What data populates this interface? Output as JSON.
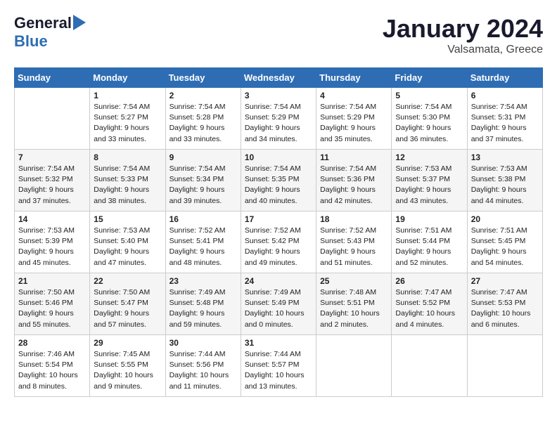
{
  "header": {
    "logo_general": "General",
    "logo_blue": "Blue",
    "month_title": "January 2024",
    "location": "Valsamata, Greece"
  },
  "days_of_week": [
    "Sunday",
    "Monday",
    "Tuesday",
    "Wednesday",
    "Thursday",
    "Friday",
    "Saturday"
  ],
  "weeks": [
    [
      {
        "day": "",
        "sunrise": "",
        "sunset": "",
        "daylight": ""
      },
      {
        "day": "1",
        "sunrise": "Sunrise: 7:54 AM",
        "sunset": "Sunset: 5:27 PM",
        "daylight": "Daylight: 9 hours and 33 minutes."
      },
      {
        "day": "2",
        "sunrise": "Sunrise: 7:54 AM",
        "sunset": "Sunset: 5:28 PM",
        "daylight": "Daylight: 9 hours and 33 minutes."
      },
      {
        "day": "3",
        "sunrise": "Sunrise: 7:54 AM",
        "sunset": "Sunset: 5:29 PM",
        "daylight": "Daylight: 9 hours and 34 minutes."
      },
      {
        "day": "4",
        "sunrise": "Sunrise: 7:54 AM",
        "sunset": "Sunset: 5:29 PM",
        "daylight": "Daylight: 9 hours and 35 minutes."
      },
      {
        "day": "5",
        "sunrise": "Sunrise: 7:54 AM",
        "sunset": "Sunset: 5:30 PM",
        "daylight": "Daylight: 9 hours and 36 minutes."
      },
      {
        "day": "6",
        "sunrise": "Sunrise: 7:54 AM",
        "sunset": "Sunset: 5:31 PM",
        "daylight": "Daylight: 9 hours and 37 minutes."
      }
    ],
    [
      {
        "day": "7",
        "sunrise": "Sunrise: 7:54 AM",
        "sunset": "Sunset: 5:32 PM",
        "daylight": "Daylight: 9 hours and 37 minutes."
      },
      {
        "day": "8",
        "sunrise": "Sunrise: 7:54 AM",
        "sunset": "Sunset: 5:33 PM",
        "daylight": "Daylight: 9 hours and 38 minutes."
      },
      {
        "day": "9",
        "sunrise": "Sunrise: 7:54 AM",
        "sunset": "Sunset: 5:34 PM",
        "daylight": "Daylight: 9 hours and 39 minutes."
      },
      {
        "day": "10",
        "sunrise": "Sunrise: 7:54 AM",
        "sunset": "Sunset: 5:35 PM",
        "daylight": "Daylight: 9 hours and 40 minutes."
      },
      {
        "day": "11",
        "sunrise": "Sunrise: 7:54 AM",
        "sunset": "Sunset: 5:36 PM",
        "daylight": "Daylight: 9 hours and 42 minutes."
      },
      {
        "day": "12",
        "sunrise": "Sunrise: 7:53 AM",
        "sunset": "Sunset: 5:37 PM",
        "daylight": "Daylight: 9 hours and 43 minutes."
      },
      {
        "day": "13",
        "sunrise": "Sunrise: 7:53 AM",
        "sunset": "Sunset: 5:38 PM",
        "daylight": "Daylight: 9 hours and 44 minutes."
      }
    ],
    [
      {
        "day": "14",
        "sunrise": "Sunrise: 7:53 AM",
        "sunset": "Sunset: 5:39 PM",
        "daylight": "Daylight: 9 hours and 45 minutes."
      },
      {
        "day": "15",
        "sunrise": "Sunrise: 7:53 AM",
        "sunset": "Sunset: 5:40 PM",
        "daylight": "Daylight: 9 hours and 47 minutes."
      },
      {
        "day": "16",
        "sunrise": "Sunrise: 7:52 AM",
        "sunset": "Sunset: 5:41 PM",
        "daylight": "Daylight: 9 hours and 48 minutes."
      },
      {
        "day": "17",
        "sunrise": "Sunrise: 7:52 AM",
        "sunset": "Sunset: 5:42 PM",
        "daylight": "Daylight: 9 hours and 49 minutes."
      },
      {
        "day": "18",
        "sunrise": "Sunrise: 7:52 AM",
        "sunset": "Sunset: 5:43 PM",
        "daylight": "Daylight: 9 hours and 51 minutes."
      },
      {
        "day": "19",
        "sunrise": "Sunrise: 7:51 AM",
        "sunset": "Sunset: 5:44 PM",
        "daylight": "Daylight: 9 hours and 52 minutes."
      },
      {
        "day": "20",
        "sunrise": "Sunrise: 7:51 AM",
        "sunset": "Sunset: 5:45 PM",
        "daylight": "Daylight: 9 hours and 54 minutes."
      }
    ],
    [
      {
        "day": "21",
        "sunrise": "Sunrise: 7:50 AM",
        "sunset": "Sunset: 5:46 PM",
        "daylight": "Daylight: 9 hours and 55 minutes."
      },
      {
        "day": "22",
        "sunrise": "Sunrise: 7:50 AM",
        "sunset": "Sunset: 5:47 PM",
        "daylight": "Daylight: 9 hours and 57 minutes."
      },
      {
        "day": "23",
        "sunrise": "Sunrise: 7:49 AM",
        "sunset": "Sunset: 5:48 PM",
        "daylight": "Daylight: 9 hours and 59 minutes."
      },
      {
        "day": "24",
        "sunrise": "Sunrise: 7:49 AM",
        "sunset": "Sunset: 5:49 PM",
        "daylight": "Daylight: 10 hours and 0 minutes."
      },
      {
        "day": "25",
        "sunrise": "Sunrise: 7:48 AM",
        "sunset": "Sunset: 5:51 PM",
        "daylight": "Daylight: 10 hours and 2 minutes."
      },
      {
        "day": "26",
        "sunrise": "Sunrise: 7:47 AM",
        "sunset": "Sunset: 5:52 PM",
        "daylight": "Daylight: 10 hours and 4 minutes."
      },
      {
        "day": "27",
        "sunrise": "Sunrise: 7:47 AM",
        "sunset": "Sunset: 5:53 PM",
        "daylight": "Daylight: 10 hours and 6 minutes."
      }
    ],
    [
      {
        "day": "28",
        "sunrise": "Sunrise: 7:46 AM",
        "sunset": "Sunset: 5:54 PM",
        "daylight": "Daylight: 10 hours and 8 minutes."
      },
      {
        "day": "29",
        "sunrise": "Sunrise: 7:45 AM",
        "sunset": "Sunset: 5:55 PM",
        "daylight": "Daylight: 10 hours and 9 minutes."
      },
      {
        "day": "30",
        "sunrise": "Sunrise: 7:44 AM",
        "sunset": "Sunset: 5:56 PM",
        "daylight": "Daylight: 10 hours and 11 minutes."
      },
      {
        "day": "31",
        "sunrise": "Sunrise: 7:44 AM",
        "sunset": "Sunset: 5:57 PM",
        "daylight": "Daylight: 10 hours and 13 minutes."
      },
      {
        "day": "",
        "sunrise": "",
        "sunset": "",
        "daylight": ""
      },
      {
        "day": "",
        "sunrise": "",
        "sunset": "",
        "daylight": ""
      },
      {
        "day": "",
        "sunrise": "",
        "sunset": "",
        "daylight": ""
      }
    ]
  ]
}
